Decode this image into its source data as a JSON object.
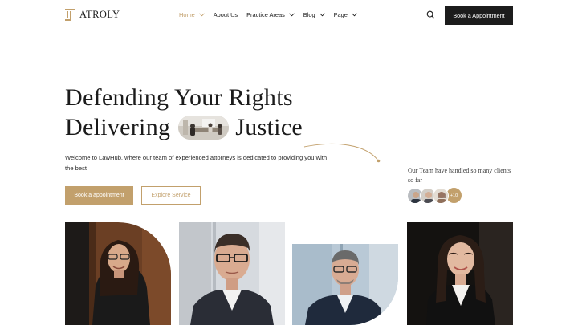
{
  "brand": {
    "name": "ATROLY",
    "accent": "#c2a06c",
    "dark": "#1c1c1c"
  },
  "nav": {
    "items": [
      {
        "label": "Home",
        "active": true,
        "dropdown": true
      },
      {
        "label": "About Us",
        "active": false,
        "dropdown": false
      },
      {
        "label": "Practice Areas",
        "active": false,
        "dropdown": true
      },
      {
        "label": "Blog",
        "active": false,
        "dropdown": true
      },
      {
        "label": "Page",
        "active": false,
        "dropdown": true
      }
    ],
    "search_icon": "search-icon",
    "cta_label": "Book a Appointment"
  },
  "hero": {
    "headline_line1": "Defending Your Rights",
    "headline_line2_a": "Delivering",
    "headline_line2_b": "Justice",
    "intro": "Welcome to LawHub, where our team of experienced attorneys is dedicated to providing you with the best",
    "primary_button": "Book a appointment",
    "secondary_button": "Explore Service"
  },
  "team_stat": {
    "text": "Our Team have handled so many clients so far",
    "more_count": "+10"
  },
  "team_photos": [
    {
      "name": "attorney-photo-1"
    },
    {
      "name": "attorney-photo-2"
    },
    {
      "name": "attorney-photo-3"
    },
    {
      "name": "attorney-photo-4"
    }
  ]
}
